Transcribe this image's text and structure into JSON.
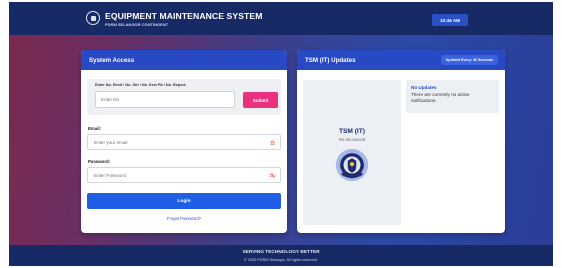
{
  "header": {
    "title": "EQUIPMENT MAINTENANCE SYSTEM",
    "subtitle": "PDRM SELANGOR CONTINGENT",
    "time": "10:46 AM"
  },
  "login_card": {
    "heading": "System Access",
    "search_label": "Enter No. Resit / No. Siri / No. Kew PA / No. Report:",
    "search_placeholder": "Enter No",
    "submit_label": "Submit",
    "email_label": "Email:",
    "email_placeholder": "Enter your email",
    "password_label": "Password:",
    "password_placeholder": "Enter Password",
    "login_label": "Login",
    "forgot_label": "Forgot Password?"
  },
  "updates_card": {
    "heading": "TSM (IT) Updates",
    "refresh_badge": "Updated Every: 30 Seconds",
    "badge_title": "TSM (IT)",
    "badge_subtitle": "IPK SELANGOR",
    "notification_title": "No Updates",
    "notification_text": "There are currently no active notifications."
  },
  "footer": {
    "line1": "SERVING TECHNOLOGY BETTER",
    "line2": "© 2025 PDRM Selangor. All rights reserved."
  },
  "colors": {
    "header_bg": "#182a66",
    "card_header": "#2749c3",
    "submit": "#e8327f",
    "login": "#1f5fe6"
  },
  "icons": [
    "shield-logo-icon",
    "lock-icon",
    "eye-slash-icon",
    "police-emblem-icon"
  ]
}
